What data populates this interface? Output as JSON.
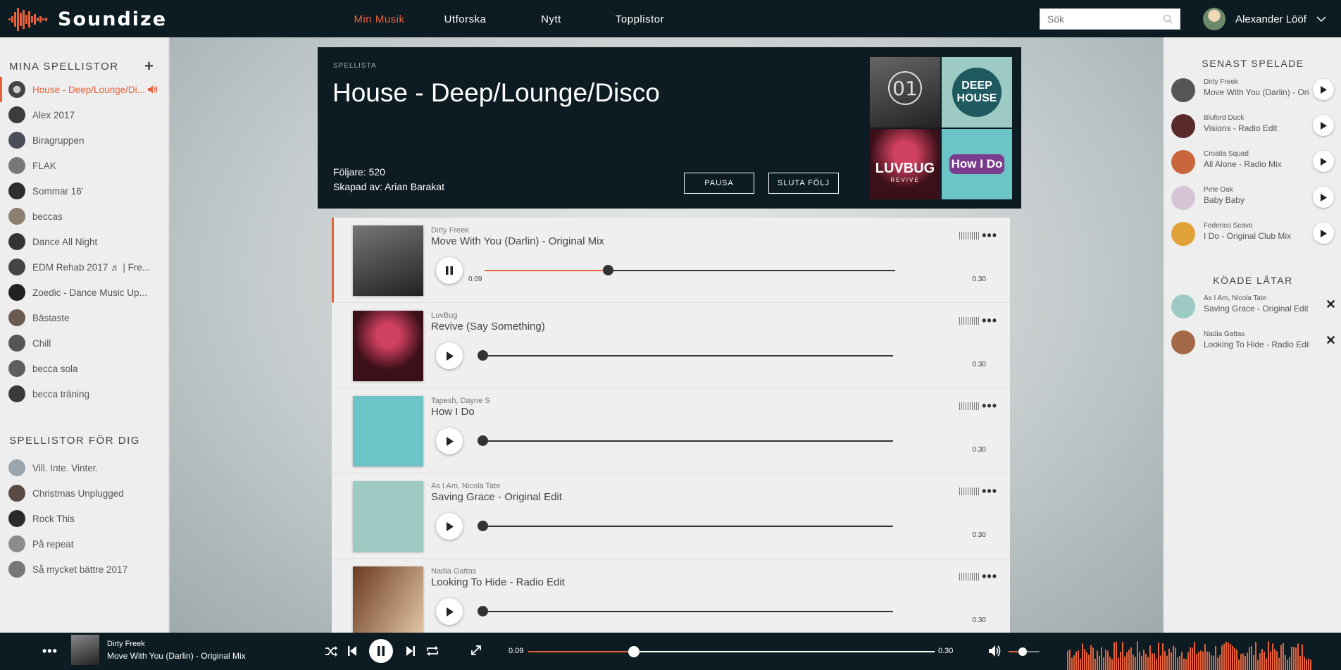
{
  "brand": {
    "name": "Soundize",
    "accent": "#e8613a",
    "dark": "#0d1c22"
  },
  "nav": [
    {
      "label": "Min Musik",
      "active": true
    },
    {
      "label": "Utforska",
      "active": false
    },
    {
      "label": "Nytt",
      "active": false
    },
    {
      "label": "Topplistor",
      "active": false
    }
  ],
  "search": {
    "placeholder": "Sök"
  },
  "user": {
    "name": "Alexander Lööf"
  },
  "left": {
    "my_title": "MINA SPELLISTOR",
    "my_playlists": [
      "House - Deep/Lounge/Di...",
      "Alex 2017",
      "Biragruppen",
      "FLAK",
      "Sommar 16'",
      "beccas",
      "Dance All Night",
      "EDM Rehab 2017 ♬ | Fre...",
      "Zoedic - Dance Music Up...",
      "Bästaste",
      "Chill",
      "becca sola",
      "becca träning"
    ],
    "for_you_title": "SPELLISTOR FÖR DIG",
    "for_you": [
      "Vill. Inte. Vinter.",
      "Christmas Unplugged",
      "Rock This",
      "På repeat",
      "Så mycket bättre 2017"
    ]
  },
  "header": {
    "label": "SPELLISTA",
    "title": "House - Deep/Lounge/Disco",
    "followers": "Följare: 520",
    "creator": "Skapad av: Arian Barakat",
    "pause_label": "PAUSA",
    "unfollow_label": "SLUTA FÖLJ"
  },
  "covers": {
    "c1": "01",
    "c2_line1": "DEEP",
    "c2_line2": "HOUSE",
    "c3": "LUVBUG",
    "c3_sub": "REVIVE",
    "c4": "How I Do"
  },
  "tracks": [
    {
      "artist": "Dirty Freek",
      "title": "Move With You (Darlin) - Original Mix",
      "current": "0.09",
      "duration": "0.30",
      "progress": 0.3,
      "playing": true
    },
    {
      "artist": "LuvBug",
      "title": "Revive (Say Something)",
      "current": "",
      "duration": "0.30",
      "progress": 0,
      "playing": false
    },
    {
      "artist": "Tapesh, Dayne S",
      "title": "How I Do",
      "current": "",
      "duration": "0.30",
      "progress": 0,
      "playing": false
    },
    {
      "artist": "As I Am, Nicola Tate",
      "title": "Saving Grace - Original Edit",
      "current": "",
      "duration": "0.30",
      "progress": 0,
      "playing": false
    },
    {
      "artist": "Nadia Gattas",
      "title": "Looking To Hide - Radio Edit",
      "current": "",
      "duration": "0.30",
      "progress": 0,
      "playing": false
    }
  ],
  "right": {
    "recent_title": "SENAST SPELADE",
    "recent": [
      {
        "artist": "Dirty Freek",
        "title": "Move With You (Darlin) - Orig..."
      },
      {
        "artist": "Bluford Duck",
        "title": "Visions - Radio Edit"
      },
      {
        "artist": "Croatia Squad",
        "title": "All Alone - Radio Mix"
      },
      {
        "artist": "Pete Oak",
        "title": "Baby Baby"
      },
      {
        "artist": "Federico Scavo",
        "title": "I Do - Original Club Mix"
      }
    ],
    "queue_title": "KÖADE LÅTAR",
    "queue": [
      {
        "artist": "As I Am, Nicola Tate",
        "title": "Saving Grace - Original Edit"
      },
      {
        "artist": "Nadia Gattas",
        "title": "Looking To Hide - Radio Edit"
      }
    ]
  },
  "player": {
    "artist": "Dirty Freek",
    "title": "Move With You (Darlin) - Original Mix",
    "current": "0.09",
    "duration": "0.30",
    "progress": 0.26,
    "volume": 0.45
  }
}
